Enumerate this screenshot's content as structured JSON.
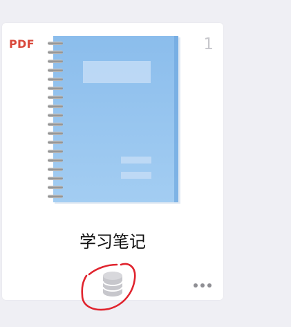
{
  "card": {
    "badge": "PDF",
    "page_count": "1",
    "title": "学习笔记"
  },
  "icons": {
    "cover": "notebook-cover-icon",
    "storage": "database-icon",
    "more": "more-options-icon",
    "annotation": "red-hand-drawn-circle"
  },
  "colors": {
    "badge": "#d9483b",
    "page_count": "#c7c7cc",
    "notebook": "#8fc1ee",
    "annotation": "#e0242e",
    "more": "#8e8e93"
  }
}
